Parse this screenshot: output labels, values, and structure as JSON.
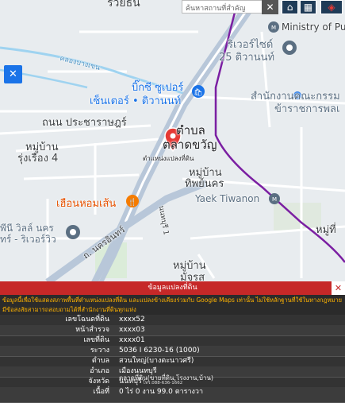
{
  "search": {
    "placeholder": "ค้นหาสถานที่สำคัญ",
    "close": "✕"
  },
  "toolbar": {
    "home": "⌂",
    "grid": "▦",
    "layers": "◈"
  },
  "map_labels": {
    "top_cut": "รวยธน",
    "ministry": "Ministry of Pub",
    "riverside1": "ริเวอร์ไซด์",
    "riverside2": "25 ติวานนท์",
    "canal": "คลองบางเขน",
    "bigc1": "บิ๊กซี ซูเปอร์",
    "bigc2": "เซ็นเตอร์ • ติวานนท์",
    "office1": "สำนักงานคณะกรรม",
    "office2": "ข้าราชการพลเ",
    "road_pracharat": "ถนน ประชาราษฎร์",
    "tambon1": "ตำบล",
    "tambon2": "ตลาดขวัญ",
    "village1": "หมู่บ้าน",
    "village1b": "รุ่งเรือง 4",
    "pin_caption": "ตำแหน่งแปลงที่ดิน",
    "village2": "หมู่บ้าน",
    "village2b": "ทิพย์นคร",
    "yaek": "Yaek Tiwanon",
    "ruean": "เฮือนหอมเส้น",
    "nonsee_road": "นนทบุรี 1",
    "villa1": "พีนี วิลล์ นคร",
    "villa2": "ทร์ - ริเวอร์วิว",
    "nakhon_road": "ถ. นครอินทร์",
    "village3": "หมู่บ้าน",
    "village3b": "มัจุรส",
    "moo_right": "หมู่ที่"
  },
  "info_panel": {
    "title": "ข้อมูลแปลงที่ดิน",
    "close": "✕",
    "notice_line1": "ข้อมูลนี้เพื่อใช้แสดงสภาพพื้นที่ตำแหน่งแปลงที่ดิน และแปลงข้างเคียงร่วมกับ Google Maps เท่านั้น ไม่ใช้หลักฐานที่ใช้ในทางกฎหมาย หาก",
    "notice_line2": "มีข้อสงสัยสามารถสอบถามได้ที่สำนักงานที่ดินทุกแห่ง",
    "rows": [
      {
        "label": "เลขโฉนดที่ดิน",
        "value": "xxxx52"
      },
      {
        "label": "หน้าสำรวจ",
        "value": "xxxx03"
      },
      {
        "label": "เลขที่ดิน",
        "value": "xxxx01"
      },
      {
        "label": "ระวาง",
        "value": "5036 I 6230-16 (1000)"
      },
      {
        "label": "ตำบล",
        "value": "สวนใหญ่(บางตะนาวศรี)"
      },
      {
        "label": "อำเภอ",
        "value": "เมืองนนทบุรี"
      },
      {
        "label": "จังหวัด",
        "value": "นนทบุรี"
      },
      {
        "label": "เนื้อที่",
        "value": "0 ไร่ 0 งาน 99.0 ตารางวา"
      }
    ],
    "watermark": "ตลาดที่ดิน(ขายที่ดิน,โรงงาน,บ้าน)",
    "watermark_tel": "โทร.088-636-1662"
  },
  "colors": {
    "accent": "#c62828",
    "map_bg": "#e8ecef",
    "road": "#ffffff",
    "highway": "#b8c7d9",
    "metro": "#7b1fa2",
    "water": "#9fd3f0"
  }
}
